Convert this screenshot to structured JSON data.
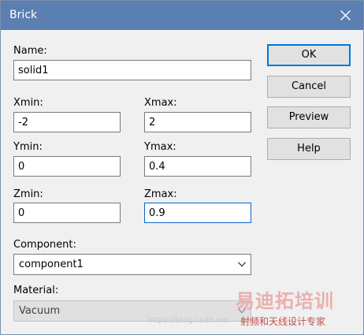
{
  "window": {
    "title": "Brick",
    "close_icon": "close-icon"
  },
  "form": {
    "name_label": "Name:",
    "name_value": "solid1",
    "xmin_label": "Xmin:",
    "xmin_value": "-2",
    "xmax_label": "Xmax:",
    "xmax_value": "2",
    "ymin_label": "Ymin:",
    "ymin_value": "0",
    "ymax_label": "Ymax:",
    "ymax_value": "0.4",
    "zmin_label": "Zmin:",
    "zmin_value": "0",
    "zmax_label": "Zmax:",
    "zmax_value": "0.9",
    "component_label": "Component:",
    "component_value": "component1",
    "material_label": "Material:",
    "material_value": "Vacuum"
  },
  "buttons": {
    "ok": "OK",
    "cancel": "Cancel",
    "preview": "Preview",
    "help": "Help"
  },
  "watermark": {
    "brand": "易迪拓培训",
    "tagline": "射频和天线设计专家",
    "url": "https://blog.csdn.net"
  },
  "colors": {
    "titlebar": "#5b7fb0",
    "default_button_border": "#0078d7",
    "focused_border": "#0a64c8"
  }
}
